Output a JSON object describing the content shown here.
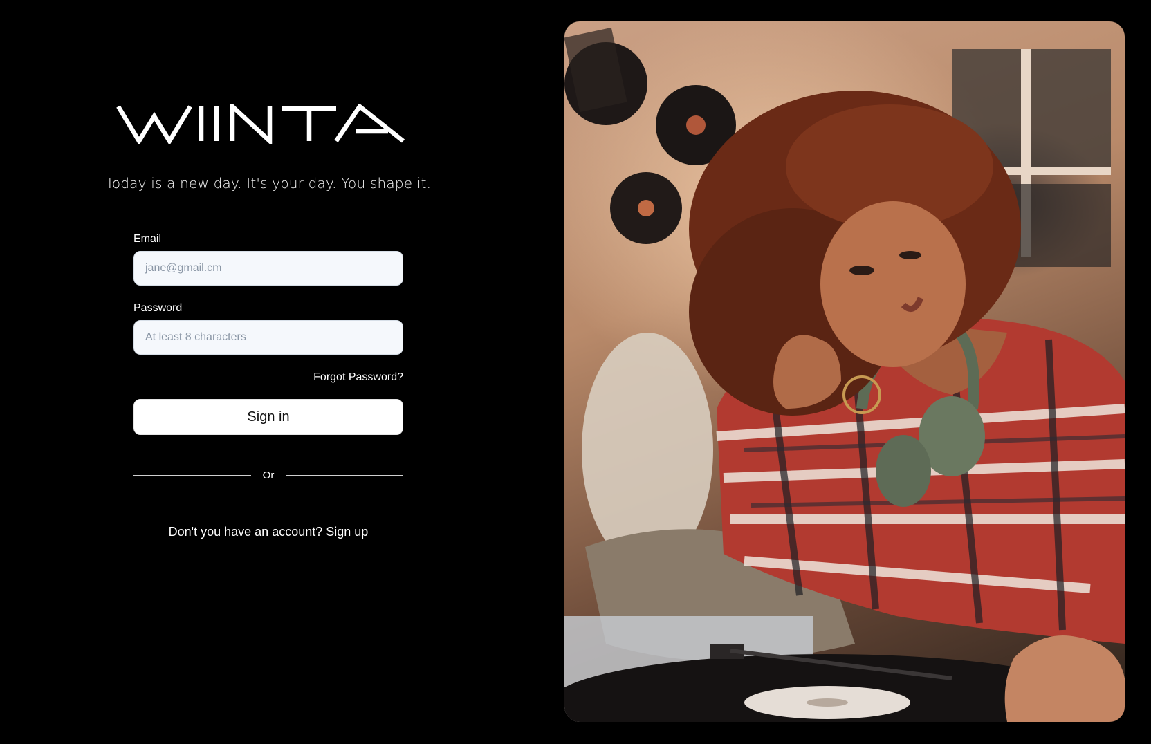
{
  "brand": {
    "logo_text": "WIINTA"
  },
  "tagline": "Today is a new day. It's your day. You shape it.",
  "form": {
    "email": {
      "label": "Email",
      "placeholder": "jane@gmail.cm",
      "value": ""
    },
    "password": {
      "label": "Password",
      "placeholder": "At least 8 characters",
      "value": ""
    },
    "forgot_label": "Forgot Password?",
    "signin_label": "Sign in"
  },
  "divider": {
    "label": "Or"
  },
  "signup": {
    "prompt": "Don't you have an account?",
    "link_label": "Sign up"
  },
  "hero_image": {
    "alt": "Woman with curly hair wearing plaid shirt and headphones beside a record player"
  },
  "colors": {
    "background": "#000000",
    "input_bg": "#f5f8fc",
    "button_bg": "#ffffff",
    "text": "#ffffff"
  }
}
